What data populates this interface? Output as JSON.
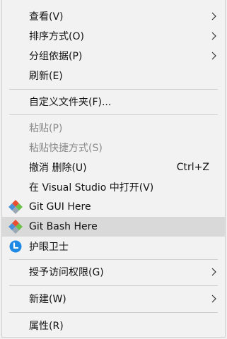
{
  "menu": {
    "view": {
      "label": "查看(V)"
    },
    "sort": {
      "label": "排序方式(O)"
    },
    "group": {
      "label": "分组依据(P)"
    },
    "refresh": {
      "label": "刷新(E)"
    },
    "customize": {
      "label": "自定义文件夹(F)..."
    },
    "paste": {
      "label": "粘贴(P)"
    },
    "paste_shortcut": {
      "label": "粘贴快捷方式(S)"
    },
    "undo_delete": {
      "label": "撤消 删除(U)",
      "shortcut": "Ctrl+Z"
    },
    "open_in_vs": {
      "label": "在 Visual Studio 中打开(V)"
    },
    "git_gui": {
      "label": "Git GUI Here",
      "icon": "git-icon"
    },
    "git_bash": {
      "label": "Git Bash Here",
      "icon": "git-icon"
    },
    "eye_guard": {
      "label": "护眼卫士",
      "icon": "eye-guard-icon"
    },
    "grant_access": {
      "label": "授予访问权限(G)"
    },
    "new": {
      "label": "新建(W)"
    },
    "properties": {
      "label": "属性(R)"
    }
  },
  "colors": {
    "menu_bg": "#f2f2f2",
    "hover_bg": "#d9d9d9",
    "disabled_text": "#8a8a8a",
    "separator": "#cfcfcf",
    "git_red": "#e94e31",
    "git_blue": "#4a90d9",
    "git_green": "#6cc04a",
    "eye_guard_blue": "#1e88e5"
  }
}
